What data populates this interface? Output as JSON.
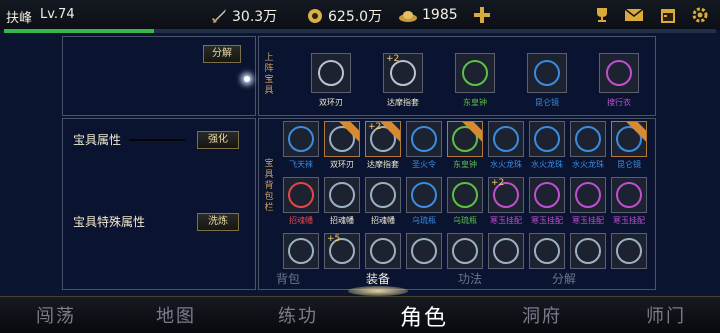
{
  "player": {
    "name": "扶峰",
    "level": "Lv.74",
    "hp_fraction": 0.21
  },
  "resources": {
    "power": "30.3万",
    "coins": "625.0万",
    "ingots": "1985"
  },
  "top_icons": [
    "add-icon",
    "trophy-icon",
    "mail-icon",
    "calendar-icon",
    "settings-icon"
  ],
  "left": {
    "decompose_btn": "分解",
    "treasure_attr_label": "宝具属性",
    "enhance_btn": "强化",
    "special_attr_label": "宝具特殊属性",
    "refine_btn": "洗炼"
  },
  "equipped": {
    "section_label": "上阵宝具",
    "items": [
      {
        "name": "双环刃",
        "color": "#f0ead0",
        "plus": ""
      },
      {
        "name": "达摩指套",
        "color": "#f0ead0",
        "plus": "+2"
      },
      {
        "name": "东皇钟",
        "color": "#5ec048",
        "plus": ""
      },
      {
        "name": "昆仑镜",
        "color": "#3a8ce0",
        "plus": ""
      },
      {
        "name": "搜行衣",
        "color": "#c050d0",
        "plus": ""
      }
    ]
  },
  "bag": {
    "section_label": "宝具背包栏",
    "rows": [
      [
        {
          "name": "飞天袜",
          "color": "#3a8ce0",
          "on": false,
          "plus": ""
        },
        {
          "name": "双环刃",
          "color": "#f0ead0",
          "on": true,
          "plus": ""
        },
        {
          "name": "达摩指套",
          "color": "#f0ead0",
          "on": true,
          "plus": "+2"
        },
        {
          "name": "圣火令",
          "color": "#3a8ce0",
          "on": false,
          "plus": ""
        },
        {
          "name": "东皇钟",
          "color": "#5ec048",
          "on": true,
          "plus": ""
        },
        {
          "name": "水火龙珠",
          "color": "#3a8ce0",
          "on": false,
          "plus": ""
        },
        {
          "name": "水火龙珠",
          "color": "#3a8ce0",
          "on": false,
          "plus": ""
        },
        {
          "name": "水火龙珠",
          "color": "#3a8ce0",
          "on": false,
          "plus": ""
        },
        {
          "name": "昆仑镜",
          "color": "#3a8ce0",
          "on": true,
          "plus": ""
        }
      ],
      [
        {
          "name": "招魂幡",
          "color": "#e04848",
          "on": false,
          "plus": ""
        },
        {
          "name": "招魂幡",
          "color": "#f0ead0",
          "on": false,
          "plus": ""
        },
        {
          "name": "招魂幡",
          "color": "#f0ead0",
          "on": false,
          "plus": ""
        },
        {
          "name": "乌琉瓶",
          "color": "#3a8ce0",
          "on": false,
          "plus": ""
        },
        {
          "name": "乌琉瓶",
          "color": "#5ec048",
          "on": false,
          "plus": ""
        },
        {
          "name": "寒玉挂配",
          "color": "#c050d0",
          "on": false,
          "plus": "+2"
        },
        {
          "name": "寒玉挂配",
          "color": "#c050d0",
          "on": false,
          "plus": ""
        },
        {
          "name": "寒玉挂配",
          "color": "#c050d0",
          "on": false,
          "plus": ""
        },
        {
          "name": "寒玉挂配",
          "color": "#c050d0",
          "on": false,
          "plus": ""
        }
      ],
      [
        {
          "name": "",
          "color": "#f0ead0",
          "on": false,
          "plus": ""
        },
        {
          "name": "",
          "color": "#f0ead0",
          "on": false,
          "plus": "+5"
        },
        {
          "name": "",
          "color": "#f0ead0",
          "on": false,
          "plus": ""
        },
        {
          "name": "",
          "color": "#f0ead0",
          "on": false,
          "plus": ""
        },
        {
          "name": "",
          "color": "#f0ead0",
          "on": false,
          "plus": ""
        },
        {
          "name": "",
          "color": "#f0ead0",
          "on": false,
          "plus": ""
        },
        {
          "name": "",
          "color": "#f0ead0",
          "on": false,
          "plus": ""
        },
        {
          "name": "",
          "color": "#f0ead0",
          "on": false,
          "plus": ""
        },
        {
          "name": "",
          "color": "#f0ead0",
          "on": false,
          "plus": ""
        }
      ]
    ]
  },
  "subtabs": [
    {
      "label": "背包",
      "active": false
    },
    {
      "label": "装备",
      "active": true
    },
    {
      "label": "功法",
      "active": false
    },
    {
      "label": "分解",
      "active": false
    }
  ],
  "nav": [
    {
      "label": "闯荡",
      "active": false
    },
    {
      "label": "地图",
      "active": false
    },
    {
      "label": "练功",
      "active": false
    },
    {
      "label": "角色",
      "active": true
    },
    {
      "label": "洞府",
      "active": false
    },
    {
      "label": "师门",
      "active": false
    }
  ]
}
